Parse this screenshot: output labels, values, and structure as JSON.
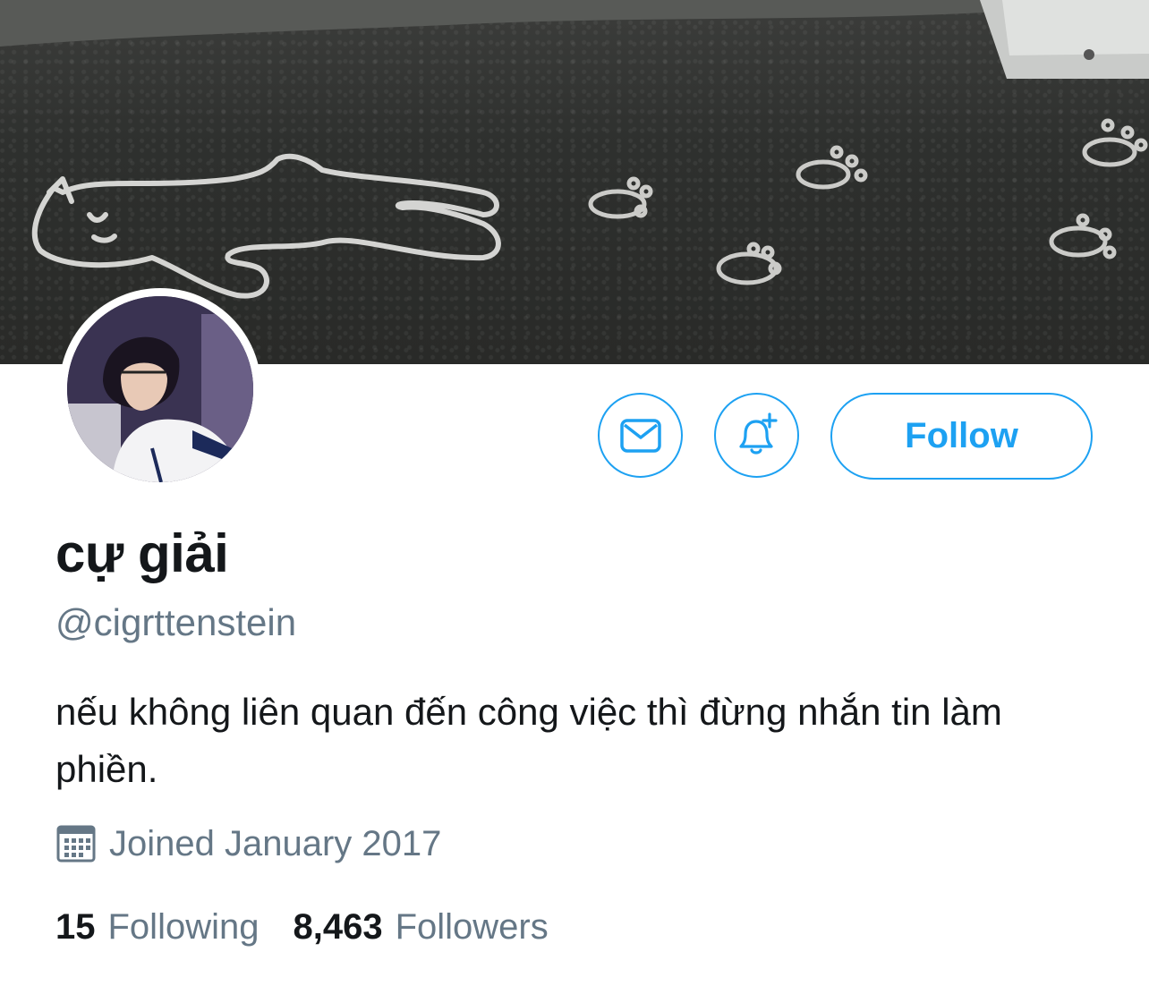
{
  "profile": {
    "display_name": "cự giải",
    "handle": "@cigrttenstein",
    "bio": "nếu không liên quan đến công việc thì đừng nhắn tin làm phiền.",
    "joined": "Joined January 2017"
  },
  "stats": {
    "following_count": "15",
    "following_label": "Following",
    "followers_count": "8,463",
    "followers_label": "Followers"
  },
  "actions": {
    "follow_label": "Follow",
    "message_icon": "envelope-icon",
    "notify_icon": "bell-plus-icon"
  },
  "colors": {
    "accent": "#1da1f2",
    "text_primary": "#14171a",
    "text_secondary": "#657786"
  }
}
